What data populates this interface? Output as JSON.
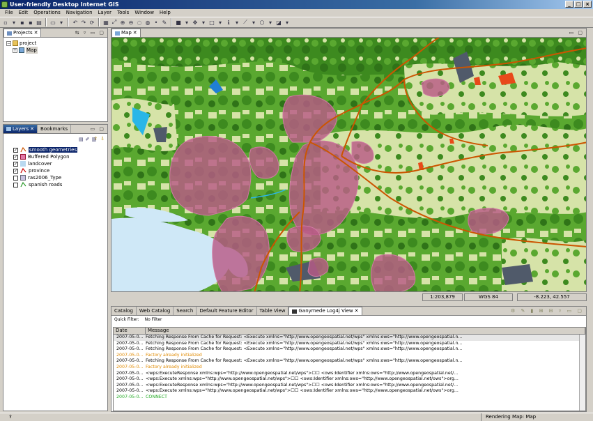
{
  "window": {
    "title": "User-friendly Desktop Internet GIS"
  },
  "menu": [
    "File",
    "Edit",
    "Operations",
    "Navigation",
    "Layer",
    "Tools",
    "Window",
    "Help"
  ],
  "projects": {
    "tab": "Projects",
    "tree": {
      "root": "project",
      "child": "Map"
    }
  },
  "layers_panel": {
    "tabs": [
      "Layers",
      "Bookmarks"
    ],
    "layers": [
      {
        "name": "smooth geometries",
        "checked": true,
        "selected": true
      },
      {
        "name": "Buffered Polygon",
        "checked": true,
        "selected": false
      },
      {
        "name": "landcover",
        "checked": true,
        "selected": false
      },
      {
        "name": "province",
        "checked": true,
        "selected": false
      },
      {
        "name": "ras2006_Type",
        "checked": false,
        "selected": false
      },
      {
        "name": "spanish roads",
        "checked": false,
        "selected": false
      }
    ]
  },
  "map": {
    "tab": "Map"
  },
  "map_status": {
    "scale": "1:203,879",
    "crs": "WGS 84",
    "coords": "-8.223, 42.557"
  },
  "log": {
    "tabs": [
      "Catalog",
      "Web Catalog",
      "Search",
      "Default Feature Editor",
      "Table View",
      "Ganymede Log4j View"
    ],
    "quick_filter_label": "Quick Filter:",
    "quick_filter_value": "No Filter",
    "col_date": "Date",
    "col_message": "Message",
    "rows": [
      {
        "date": "2007-05-0...",
        "msg": "Fetching Response From Cache for Request: <Execute xmlns=\"http://www.opengeospatial.net/wps\" xmlns:ows=\"http://www.opengeospatial.n...",
        "level": "info"
      },
      {
        "date": "2007-05-0...",
        "msg": "Fetching Response From Cache for Request: <Execute xmlns=\"http://www.opengeospatial.net/wps\" xmlns:ows=\"http://www.opengeospatial.n...",
        "level": "info"
      },
      {
        "date": "2007-05-0...",
        "msg": "Fetching Response From Cache for Request: <Execute xmlns=\"http://www.opengeospatial.net/wps\" xmlns:ows=\"http://www.opengeospatial.n...",
        "level": "info"
      },
      {
        "date": "2007-05-0...",
        "msg": "Factory already initialized",
        "level": "warn"
      },
      {
        "date": "2007-05-0...",
        "msg": "Fetching Response From Cache for Request: <Execute xmlns=\"http://www.opengeospatial.net/wps\" xmlns:ows=\"http://www.opengeospatial.n...",
        "level": "info"
      },
      {
        "date": "2007-05-0...",
        "msg": "Factory already initialized",
        "level": "warn"
      },
      {
        "date": "2007-05-0...",
        "msg": "<wps:ExecuteResponse xmlns:wps=\"http://www.opengeospatial.net/wps\">☐☐    <ows:Identifier xmlns:ows=\"http://www.opengeospatial.net/...",
        "level": "info"
      },
      {
        "date": "2007-05-0...",
        "msg": "<wps:Execute xmlns:wps=\"http://www.opengeospatial.net/wps\">☐☐  <ows:Identifier xmlns:ows=\"http://www.opengeospatial.net/ows\">org...",
        "level": "info"
      },
      {
        "date": "2007-05-0...",
        "msg": "<wps:ExecuteResponse xmlns:wps=\"http://www.opengeospatial.net/wps\">☐☐    <ows:Identifier xmlns:ows=\"http://www.opengeospatial.net/...",
        "level": "info"
      },
      {
        "date": "2007-05-0...",
        "msg": "<wps:Execute xmlns:wps=\"http://www.opengeospatial.net/wps\">☐☐  <ows:Identifier xmlns:ows=\"http://www.opengeospatial.net/ows\">org...",
        "level": "info"
      },
      {
        "date": "2007-05-0...",
        "msg": "CONNECT",
        "level": "ok"
      }
    ]
  },
  "status": {
    "text": "Rendering Map: Map"
  },
  "colors": {
    "title_bar": "#0a246a",
    "forest_dark": "#3d8a1f",
    "forest": "#5aa830",
    "pasture": "#d6e3a8",
    "water": "#cfe8f7",
    "buffer": "#b85a86",
    "roads": "#cc5500"
  }
}
